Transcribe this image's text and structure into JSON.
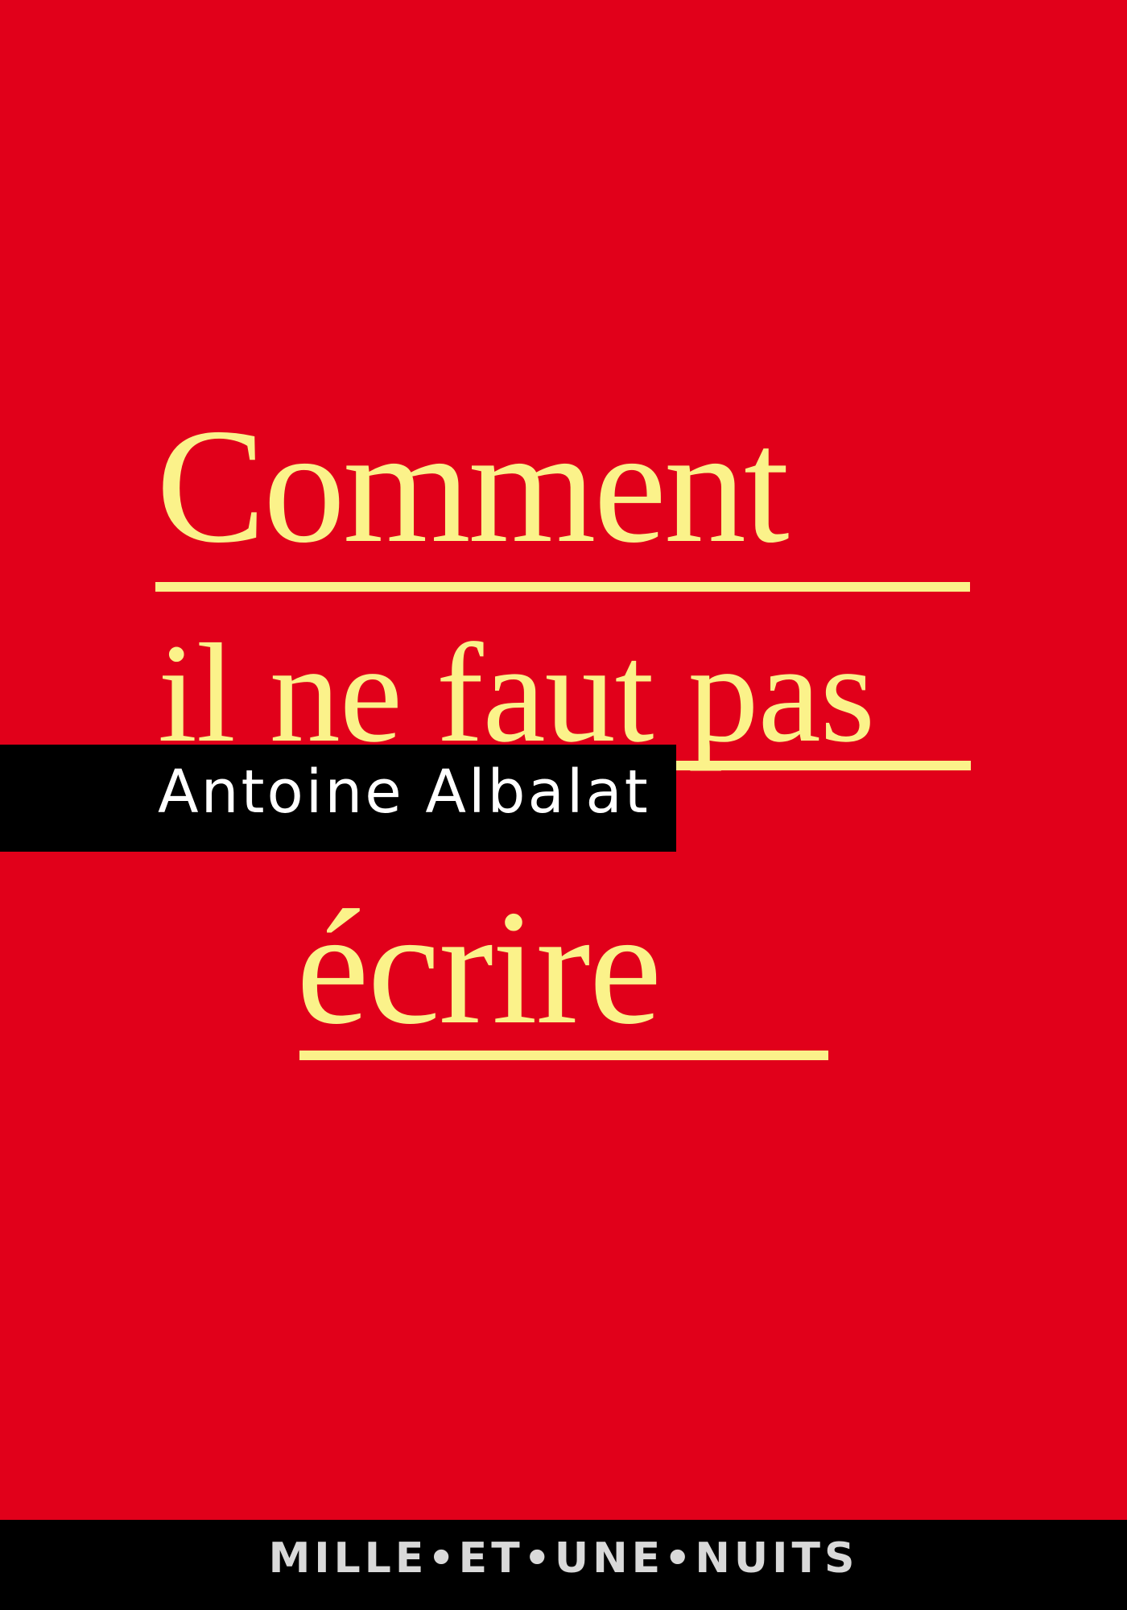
{
  "book": {
    "title_line1": "Comment",
    "title_line2": "il ne faut pas",
    "title_line3": "écrire",
    "author": "Antoine Albalat",
    "publisher": "MILLE•ET•UNE•NUITS"
  },
  "colors": {
    "background": "#e1001a",
    "title": "#fbf28a",
    "band": "#000000",
    "author_text": "#ffffff",
    "publisher_text": "#d9d9d9"
  }
}
